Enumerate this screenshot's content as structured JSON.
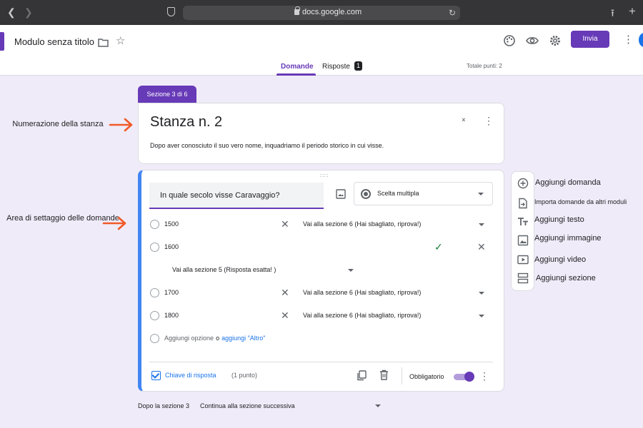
{
  "browser": {
    "url": "docs.google.com"
  },
  "header": {
    "form_title": "Modulo senza titolo",
    "send_label": "Invia",
    "icons": [
      "folder-icon",
      "star-icon",
      "palette-icon",
      "eye-icon",
      "gear-icon",
      "more-vert-icon"
    ]
  },
  "tabs": {
    "questions": "Domande",
    "responses": "Risposte",
    "responses_count": "1",
    "total_points": "Totale punti: 2"
  },
  "section": {
    "tab_label": "Sezione 3 di 6",
    "title": "Stanza n. 2",
    "description": "Dopo aver conosciuto il suo vero nome, inquadriamo il periodo storico in cui visse."
  },
  "question": {
    "title": "In quale secolo visse Caravaggio?",
    "type": "Scelta multipla",
    "options": [
      {
        "label": "1500",
        "goto": "Vai alla sezione 6 (Hai sbagliato, riprova!)"
      },
      {
        "label": "1600",
        "goto": "Vai alla sezione 5 (Risposta esatta! )",
        "correct": true
      },
      {
        "label": "1700",
        "goto": "Vai alla sezione 6 (Hai sbagliato, riprova!)"
      },
      {
        "label": "1800",
        "goto": "Vai alla sezione 6 (Hai sbagliato, riprova!)"
      }
    ],
    "add_option": "Aggiungi opzione",
    "or_text": "o",
    "add_other": "aggiungi \"Altro\"",
    "answer_key": "Chiave di risposta",
    "points": "(1 punto)",
    "required_label": "Obbligatorio",
    "required_on": true
  },
  "after_section": {
    "label": "Dopo la sezione 3",
    "action": "Continua alla sezione successiva"
  },
  "toolbar": {
    "add_question": "Aggiungi domanda",
    "import_questions": "Importa  domande da altri moduli",
    "add_text": "Aggiungi testo",
    "add_image": "Aggiungi immagine",
    "add_video": "Aggiungi video",
    "add_section": "Aggiungi sezione"
  },
  "annotations": {
    "room_numbering": "Numerazione della stanza",
    "question_settings": "Area di settaggio delle domande"
  },
  "colors": {
    "accent": "#673ab7",
    "background": "#f0ebf8",
    "active_border": "#4285f4",
    "arrow": "#f05a28",
    "check": "#188038",
    "link": "#1a73e8"
  }
}
